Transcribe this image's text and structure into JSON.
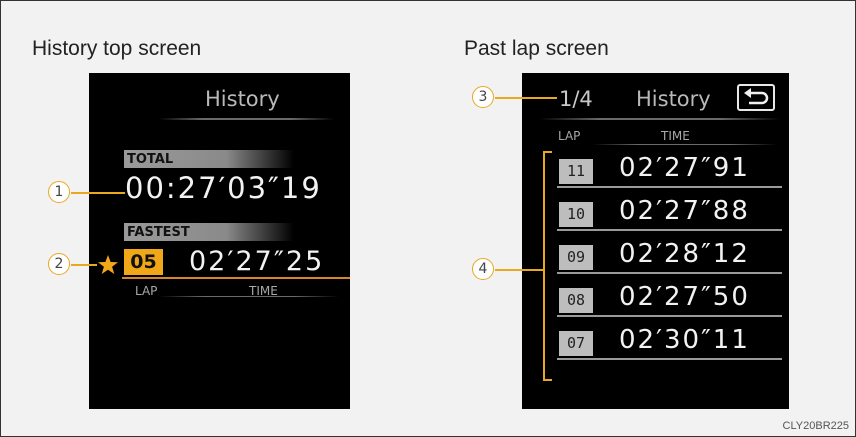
{
  "left_panel": {
    "title": "History top screen",
    "screen": {
      "header": "History",
      "total_label": "TOTAL",
      "total_time": "00:27′03″19",
      "fastest_label": "FASTEST",
      "fastest_lap": "05",
      "fastest_time": "02′27″25",
      "col_lap": "LAP",
      "col_time": "TIME"
    },
    "callouts": [
      "1",
      "2"
    ]
  },
  "right_panel": {
    "title": "Past lap screen",
    "screen": {
      "page": "1/4",
      "header": "History",
      "col_lap": "LAP",
      "col_time": "TIME",
      "rows": [
        {
          "lap": "11",
          "time": "02′27″91"
        },
        {
          "lap": "10",
          "time": "02′27″88"
        },
        {
          "lap": "09",
          "time": "02′28″12"
        },
        {
          "lap": "08",
          "time": "02′27″50"
        },
        {
          "lap": "07",
          "time": "02′30″11"
        }
      ]
    },
    "callouts": [
      "3",
      "4"
    ]
  },
  "footer_code": "CLY20BR225",
  "colors": {
    "accent": "#e8a820",
    "screen_bg": "#000000",
    "lap_box": "#bdbdbd"
  },
  "icons": {
    "star": "star-icon",
    "back": "back-arrow-icon"
  }
}
